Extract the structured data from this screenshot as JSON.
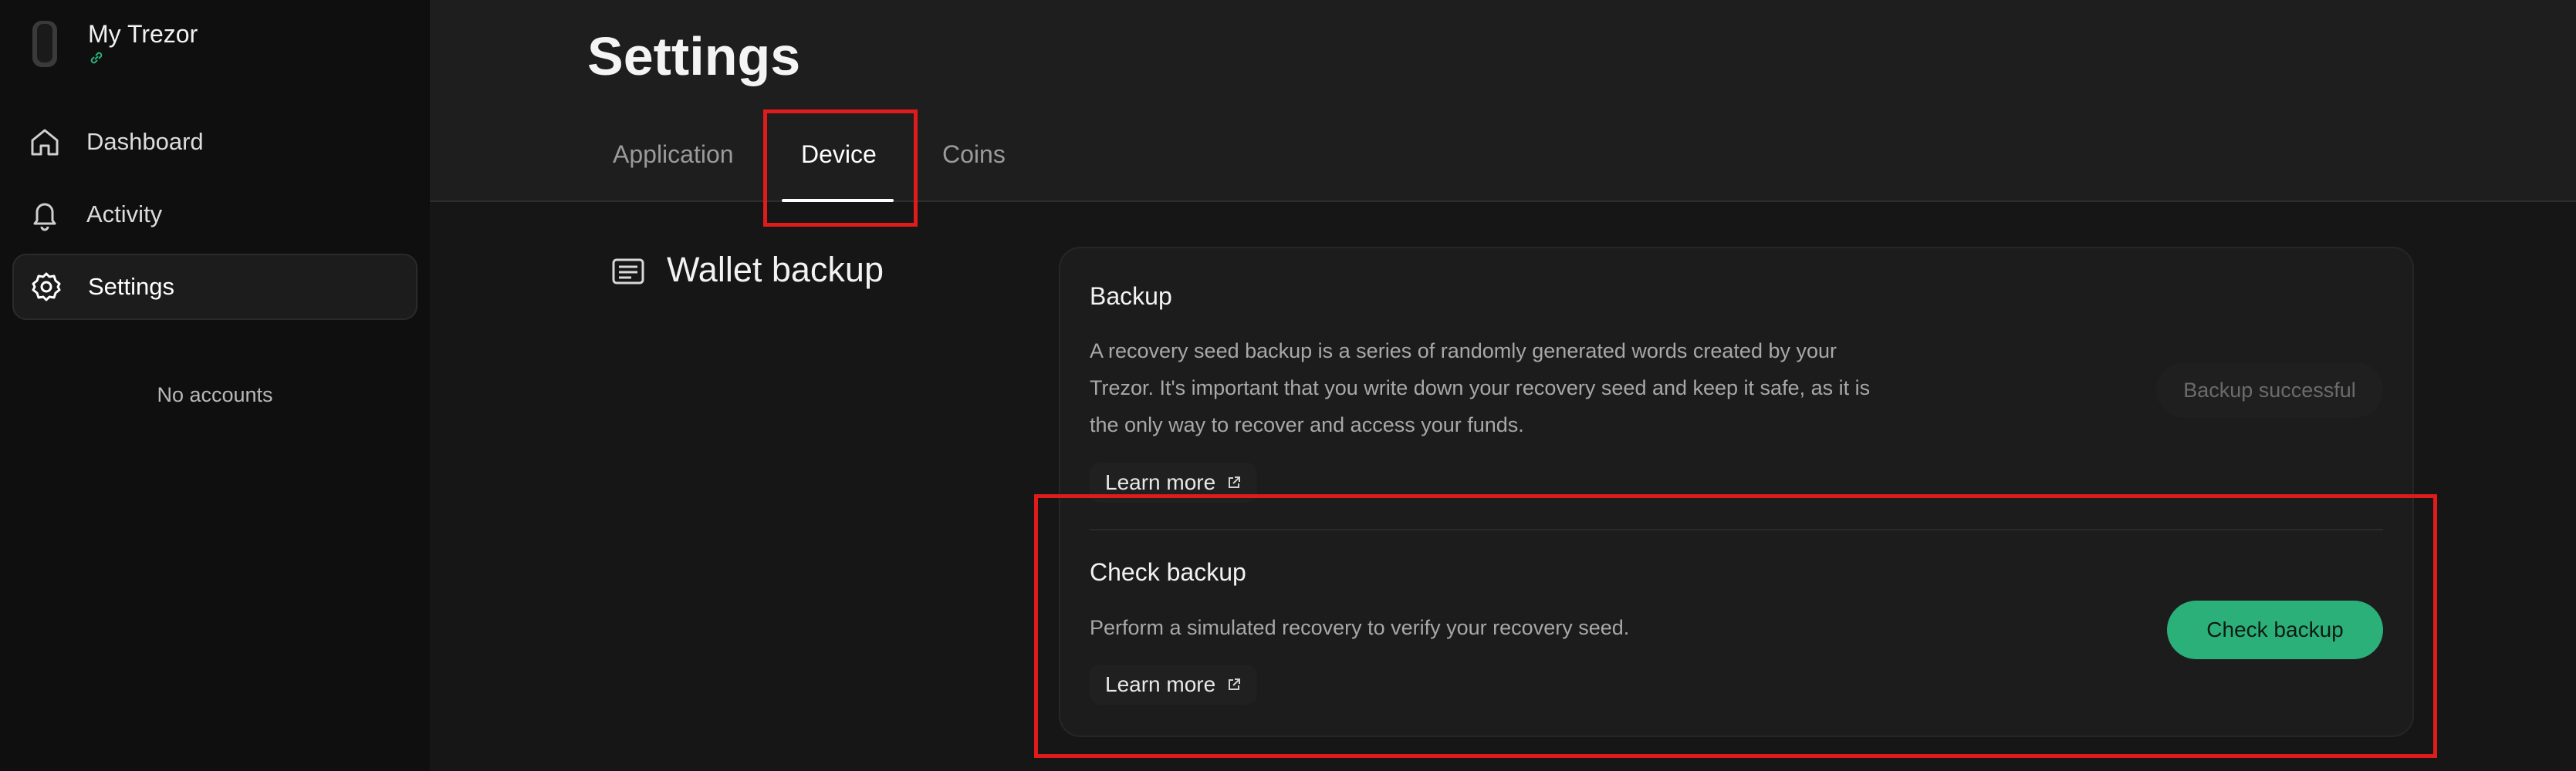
{
  "sidebar": {
    "device_name": "My Trezor",
    "items": [
      {
        "label": "Dashboard",
        "icon": "home-icon"
      },
      {
        "label": "Activity",
        "icon": "bell-icon"
      },
      {
        "label": "Settings",
        "icon": "gear-icon",
        "active": true
      }
    ],
    "no_accounts": "No accounts"
  },
  "header": {
    "title": "Settings",
    "tabs": [
      {
        "label": "Application"
      },
      {
        "label": "Device",
        "active": true
      },
      {
        "label": "Coins"
      }
    ]
  },
  "section": {
    "title": "Wallet backup",
    "icon": "list-card-icon"
  },
  "backup": {
    "title": "Backup",
    "description": "A recovery seed backup is a series of randomly generated words created by your Trezor. It's important that you write down your recovery seed and keep it safe, as it is the only way to recover and access your funds.",
    "learn_more": "Learn more",
    "status_button": "Backup successful"
  },
  "check_backup": {
    "title": "Check backup",
    "description": "Perform a simulated recovery to verify your recovery seed.",
    "learn_more": "Learn more",
    "button": "Check backup"
  },
  "colors": {
    "accent": "#2bb07a",
    "highlight": "#e01b1b",
    "link_icon": "#2bb07a"
  }
}
